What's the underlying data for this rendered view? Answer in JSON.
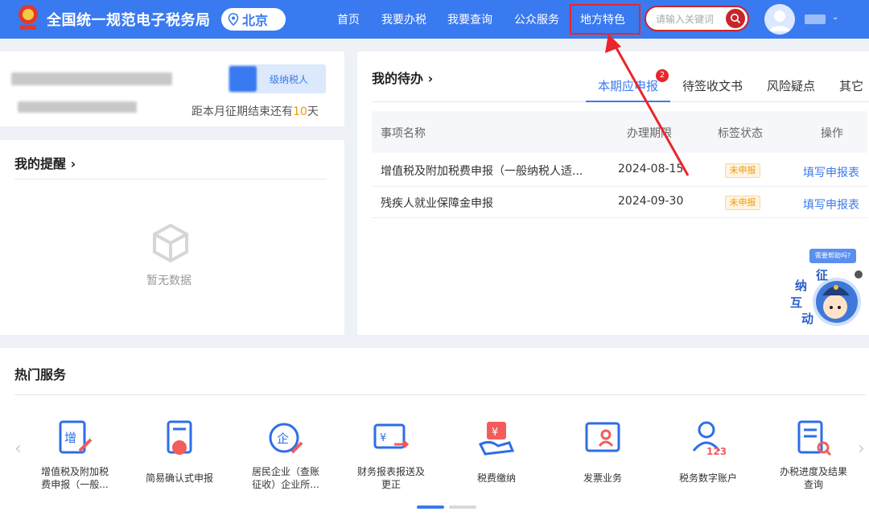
{
  "header": {
    "site_title": "全国统一规范电子税务局",
    "region": "北京",
    "nav": [
      "首页",
      "我要办税",
      "我要查询",
      "公众服务",
      "地方特色"
    ],
    "search_placeholder": "请输入关键词",
    "brand_color": "#3a7af0",
    "highlight_color": "#e8262b"
  },
  "profile": {
    "taxpayer_type": "级纳税人",
    "period_prefix": "距本月征期结束还有",
    "period_days": "10",
    "period_suffix": "天"
  },
  "reminders": {
    "title": "我的提醒 ›",
    "empty_text": "暂无数据"
  },
  "todo": {
    "title": "我的待办 ›",
    "tabs": [
      "本期应申报",
      "待签收文书",
      "风险疑点",
      "其它"
    ],
    "active_tab_badge": "2",
    "columns": [
      "事项名称",
      "办理期限",
      "标签状态",
      "操作"
    ],
    "rows": [
      {
        "name": "增值税及附加税费申报（一般纳税人适...",
        "deadline": "2024-08-15",
        "status": "未申报",
        "action": "填写申报表"
      },
      {
        "name": "残疾人就业保障金申报",
        "deadline": "2024-09-30",
        "status": "未申报",
        "action": "填写申报表"
      }
    ]
  },
  "assistant": {
    "bubble": "需要帮助吗?",
    "chars": [
      "征",
      "纳",
      "互",
      "动"
    ]
  },
  "services": {
    "title": "热门服务",
    "items": [
      {
        "label1": "增值税及附加税",
        "label2": "费申报（一般...",
        "icon": "vat-declare-icon"
      },
      {
        "label1": "简易确认式申报",
        "label2": "",
        "icon": "simple-declare-icon"
      },
      {
        "label1": "居民企业（查账",
        "label2": "征收）企业所...",
        "icon": "enterprise-tax-icon"
      },
      {
        "label1": "财务报表报送及",
        "label2": "更正",
        "icon": "financial-report-icon"
      },
      {
        "label1": "税费缴纳",
        "label2": "",
        "icon": "tax-payment-icon"
      },
      {
        "label1": "发票业务",
        "label2": "",
        "icon": "invoice-icon"
      },
      {
        "label1": "税务数字账户",
        "label2": "",
        "icon": "digital-account-icon"
      },
      {
        "label1": "办税进度及结果",
        "label2": "查询",
        "icon": "progress-query-icon"
      }
    ]
  }
}
